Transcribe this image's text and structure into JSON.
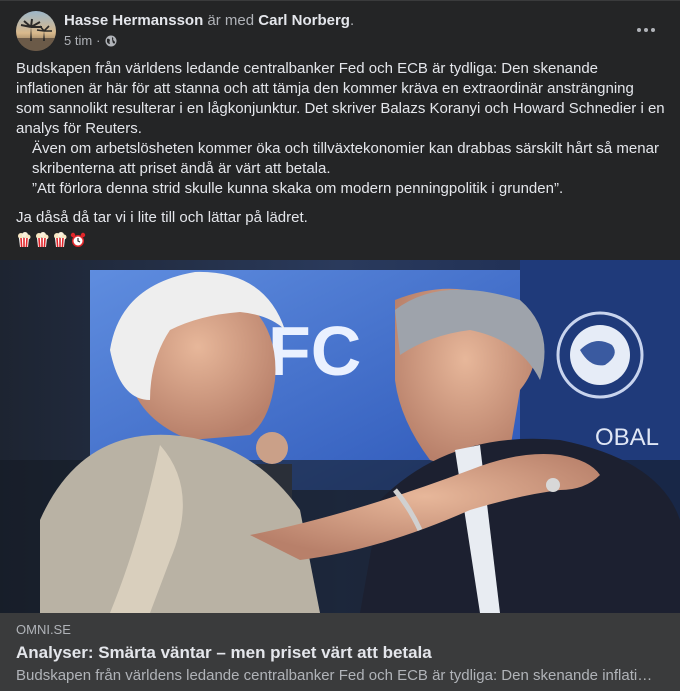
{
  "post": {
    "author": "Hasse Hermansson",
    "with_text": "är med",
    "tagged": "Carl Norberg",
    "end_punct": ".",
    "time": "5 tim",
    "dot": "·",
    "privacy_icon": "globe-icon",
    "more_icon": "more-horizontal-icon",
    "paragraphs": {
      "p1": "Budskapen från världens ledande centralbanker Fed och ECB är tydliga: Den skenande inflationen är här för att stanna och att tämja den kommer kräva en extraordinär ansträngning som sannolikt resulterar i en lågkonjunktur. Det skriver Balazs Koranyi och Howard Schnedier i en analys för Reuters.",
      "p2": "Även om arbetslösheten kommer öka och tillväxtekonomier kan drabbas särskilt hårt så menar skribenterna att priset ändå är värt att betala.",
      "p3": "”Att förlora denna strid skulle kunna skaka om modern penningpolitik i grunden”.",
      "p4": "Ja dåså då tar vi i lite till och lättar på lädret."
    },
    "emojis": [
      "popcorn",
      "popcorn",
      "popcorn",
      "alarm-clock"
    ],
    "photo_text": {
      "screen": "FC",
      "right": "OBAL"
    }
  },
  "link_preview": {
    "domain": "OMNI.SE",
    "title": "Analyser: Smärta väntar – men priset värt att betala",
    "description": "Budskapen från världens ledande centralbanker Fed och ECB är tydliga: Den skenande inflationen är här för att stanna och att tämja den kommer kräva en extraordinär ansträngning"
  },
  "colors": {
    "background": "#242526",
    "preview_background": "#3a3b3c",
    "primary_text": "#e4e6eb",
    "secondary_text": "#b0b3b8"
  }
}
